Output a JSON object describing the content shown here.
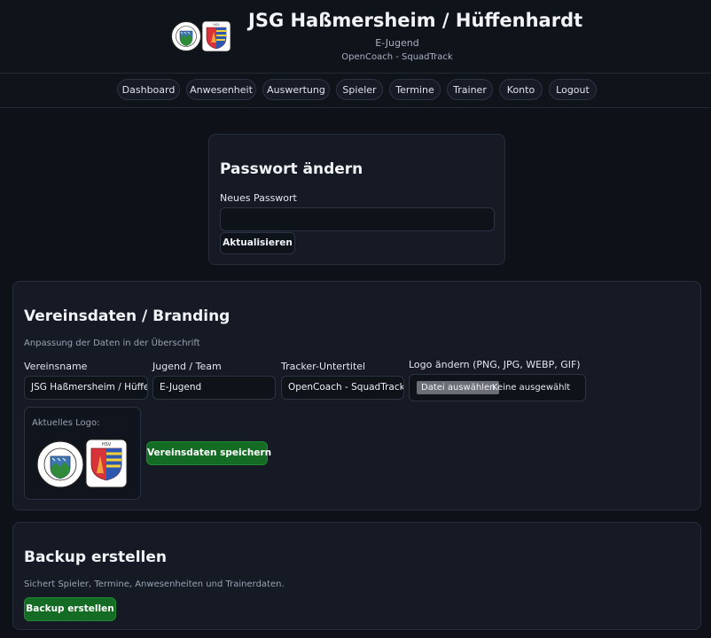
{
  "header": {
    "title": "JSG Haßmersheim / Hüffenhardt",
    "team": "E-Jugend",
    "subtitle": "OpenCoach - SquadTrack",
    "colors": {
      "background": "#0f131a",
      "title": "#f2f4f8"
    }
  },
  "nav": {
    "items": [
      {
        "label": "Dashboard"
      },
      {
        "label": "Anwesenheit"
      },
      {
        "label": "Auswertung"
      },
      {
        "label": "Spieler"
      },
      {
        "label": "Termine"
      },
      {
        "label": "Trainer"
      },
      {
        "label": "Konto"
      },
      {
        "label": "Logout"
      }
    ]
  },
  "password": {
    "title": "Passwort ändern",
    "field_label": "Neues Passwort",
    "field_value": "",
    "submit_label": "Aktualisieren"
  },
  "branding": {
    "title": "Vereinsdaten / Branding",
    "description": "Anpassung der Daten in der Überschrift",
    "club_label": "Vereinsname",
    "club_value": "JSG Haßmersheim / Hüffenhardt",
    "team_label": "Jugend / Team",
    "team_value": "E-Jugend",
    "subtitle_label": "Tracker-Untertitel",
    "subtitle_value": "OpenCoach - SquadTrack",
    "logo_label": "Logo ändern (PNG, JPG, WEBP, GIF)",
    "file_button": "Datei auswählen",
    "file_status": "Keine ausgewählt",
    "current_logo_label": "Aktuelles Logo:",
    "save_label": "Vereinsdaten speichern"
  },
  "backup": {
    "title": "Backup erstellen",
    "description": "Sichert Spieler, Termine, Anwesenheiten und Trainerdaten.",
    "button_label": "Backup erstellen"
  },
  "colors": {
    "page_bg": "#0e1117",
    "card_bg": "#151a24",
    "accent_green": "#146b23",
    "border": "#262e3c"
  }
}
